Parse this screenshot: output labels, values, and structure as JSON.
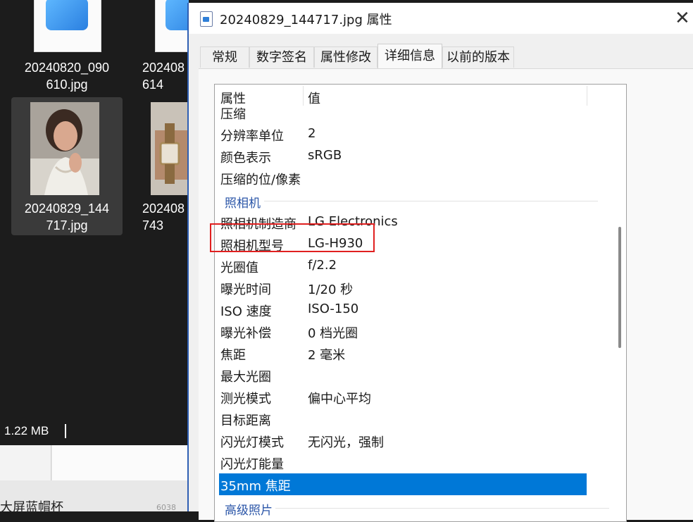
{
  "explorer": {
    "files": [
      {
        "name": "20240820_090\n610.jpg"
      },
      {
        "name": "202408\n614"
      },
      {
        "name": "20240829_144\n717.jpg"
      },
      {
        "name": "202408\n743"
      }
    ],
    "status_size": "1.22 MB",
    "bottom_text": "大屏蓝帽杯",
    "bottom_mini": "6038"
  },
  "dialog": {
    "title": "20240829_144717.jpg 属性",
    "close_glyph": "✕",
    "tabs": [
      "常规",
      "数字签名",
      "属性修改",
      "详细信息",
      "以前的版本"
    ],
    "active_tab": "详细信息",
    "columns": {
      "property": "属性",
      "value": "值"
    },
    "rows": [
      {
        "name": "压缩",
        "value": ""
      },
      {
        "name": "分辨率单位",
        "value": "2"
      },
      {
        "name": "颜色表示",
        "value": "sRGB"
      },
      {
        "name": "压缩的位/像素",
        "value": ""
      },
      {
        "group": "照相机"
      },
      {
        "name": "照相机制造商",
        "value": "LG Electronics"
      },
      {
        "name": "照相机型号",
        "value": "LG-H930"
      },
      {
        "name": "光圈值",
        "value": "f/2.2"
      },
      {
        "name": "曝光时间",
        "value": "1/20 秒"
      },
      {
        "name": "ISO 速度",
        "value": "ISO-150"
      },
      {
        "name": "曝光补偿",
        "value": "0 档光圈"
      },
      {
        "name": "焦距",
        "value": "2 毫米"
      },
      {
        "name": "最大光圈",
        "value": ""
      },
      {
        "name": "测光模式",
        "value": "偏中心平均"
      },
      {
        "name": "目标距离",
        "value": ""
      },
      {
        "name": "闪光灯模式",
        "value": "无闪光，强制"
      },
      {
        "name": "闪光灯能量",
        "value": ""
      },
      {
        "name": "35mm 焦距",
        "value": "",
        "selected": true
      },
      {
        "group": "高级照片"
      }
    ],
    "highlighted_row": "照相机型号",
    "colors": {
      "selection": "#0078d7",
      "highlight_box": "#e02020",
      "group_title": "#2b56a8"
    }
  }
}
